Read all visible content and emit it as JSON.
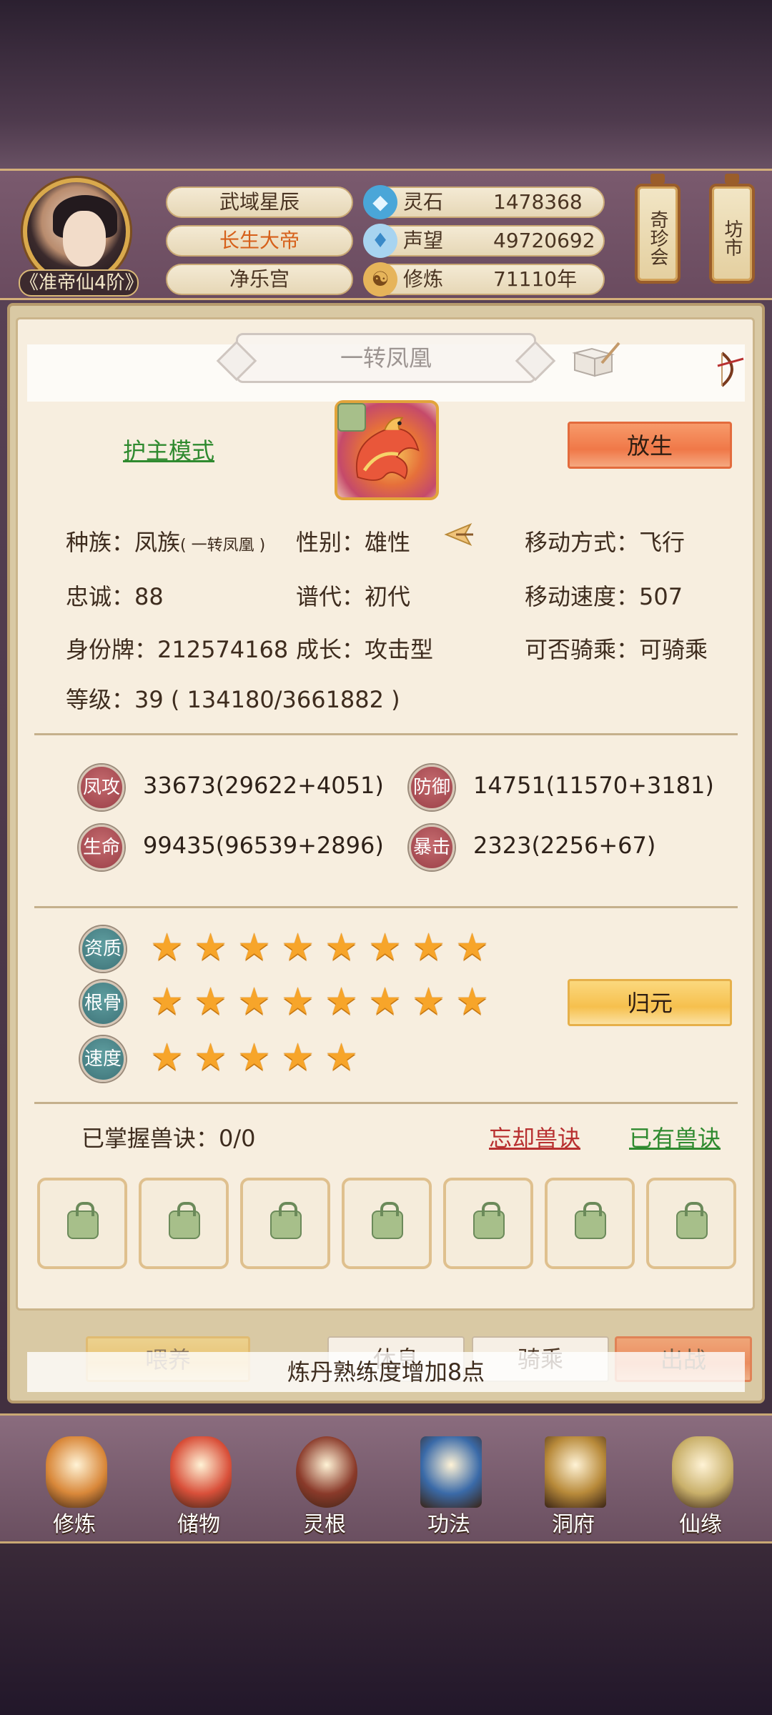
{
  "header": {
    "rank": "《准帝仙4阶》",
    "titles": [
      "武域星辰",
      "长生大帝",
      "净乐宫"
    ],
    "resources": [
      {
        "icon": "spirit-stone-icon",
        "label": "灵石",
        "value": "1478368"
      },
      {
        "icon": "prestige-icon",
        "label": "声望",
        "value": "49720692"
      },
      {
        "icon": "cultivation-icon",
        "label": "修炼",
        "value": "71110年"
      }
    ],
    "side_buttons": [
      "奇珍会",
      "坊市"
    ]
  },
  "pet": {
    "name": "一转凤凰",
    "guard_mode": "护主模式",
    "release_button": "放生",
    "race_label": "种族：",
    "race_value": "凤族",
    "race_sub": "( 一转凤凰 )",
    "gender": "性别：雄性",
    "movement": "移动方式：飞行",
    "loyalty": "忠诚：88",
    "generation": "谱代：初代",
    "move_speed": "移动速度：507",
    "id_card": "身份牌：212574168",
    "growth": "成长：攻击型",
    "rideable": "可否骑乘：可骑乘",
    "level": "等级：39 ( 134180/3661882 )"
  },
  "stats": [
    {
      "label": "凤攻",
      "value": "33673(29622+4051)"
    },
    {
      "label": "防御",
      "value": "14751(11570+3181)"
    },
    {
      "label": "生命",
      "value": "99435(96539+2896)"
    },
    {
      "label": "暴击",
      "value": "2323(2256+67)"
    }
  ],
  "attributes": [
    {
      "label": "资质",
      "stars": 8
    },
    {
      "label": "根骨",
      "stars": 8
    },
    {
      "label": "速度",
      "stars": 5
    }
  ],
  "return_button": "归元",
  "skills": {
    "mastered": "已掌握兽诀：0/0",
    "forget": "忘却兽诀",
    "owned": "已有兽诀",
    "slots": 7
  },
  "actions": [
    "喂养",
    "休息",
    "骑乘",
    "出战"
  ],
  "toast": "炼丹熟练度增加8点",
  "nav": [
    {
      "label": "修炼",
      "color": "#d9883a"
    },
    {
      "label": "储物",
      "color": "#d9503a"
    },
    {
      "label": "灵根",
      "color": "#8a3a2a"
    },
    {
      "label": "功法",
      "color": "#3a6aa8"
    },
    {
      "label": "洞府",
      "color": "#b88a3a"
    },
    {
      "label": "仙缘",
      "color": "#c9b06a"
    }
  ]
}
